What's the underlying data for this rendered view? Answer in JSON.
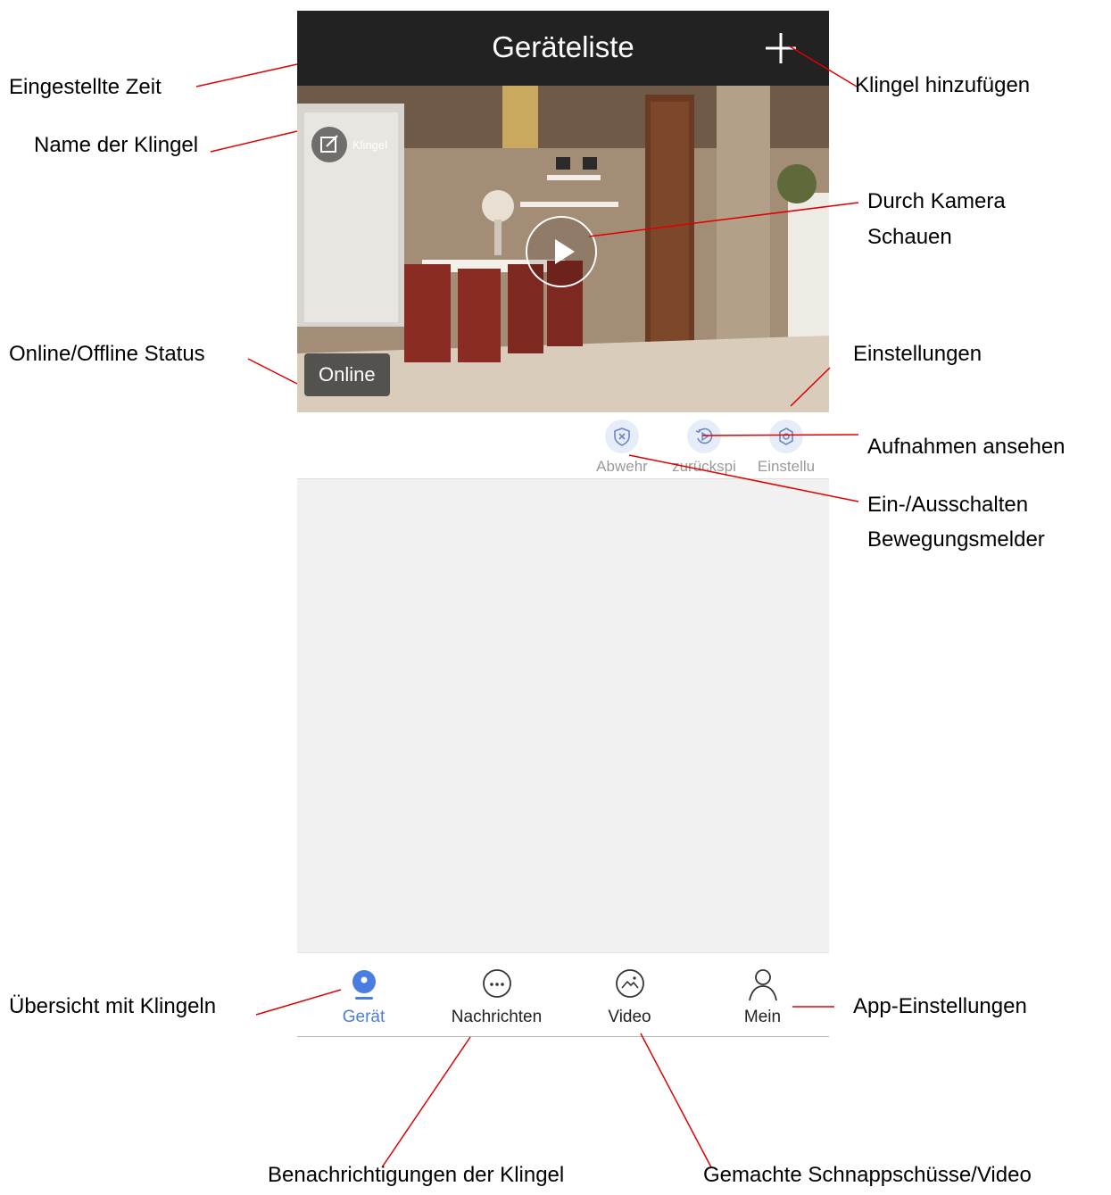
{
  "app": {
    "header_title": "Geräteliste",
    "add_icon": "plus-icon"
  },
  "camera": {
    "doorbell_name": "Klingel",
    "status": "Online",
    "edit_icon": "edit-icon",
    "play_icon": "play-icon"
  },
  "actions": [
    {
      "label": "Abwehr",
      "icon": "shield-x-icon"
    },
    {
      "label": "zurückspi",
      "icon": "replay-icon"
    },
    {
      "label": "Einstellu",
      "icon": "gear-icon"
    }
  ],
  "tabs": [
    {
      "label": "Gerät",
      "icon": "camera-icon",
      "active": true
    },
    {
      "label": "Nachrichten",
      "icon": "chat-bubble-icon",
      "active": false
    },
    {
      "label": "Video",
      "icon": "picture-icon",
      "active": false
    },
    {
      "label": "Mein",
      "icon": "user-icon",
      "active": false
    }
  ],
  "annotations": {
    "set_time": "Eingestellte Zeit",
    "doorbell_name": "Name der Klingel",
    "online_status": "Online/Offline Status",
    "overview": "Übersicht mit Klingeln",
    "add_doorbell": "Klingel hinzufügen",
    "view_camera_1": "Durch Kamera",
    "view_camera_2": "Schauen",
    "settings": "Einstellungen",
    "recordings": "Aufnahmen ansehen",
    "motion_1": "Ein-/Ausschalten",
    "motion_2": "Bewegungsmelder",
    "app_settings": "App-Einstellungen",
    "notifications": "Benachrichtigungen der Klingel",
    "snapshots": "Gemachte Schnappschüsse/Video"
  },
  "colors": {
    "header": "#222222",
    "accent": "#4a7de0",
    "callout_line": "#e00000",
    "background": "#f1f1f1"
  }
}
